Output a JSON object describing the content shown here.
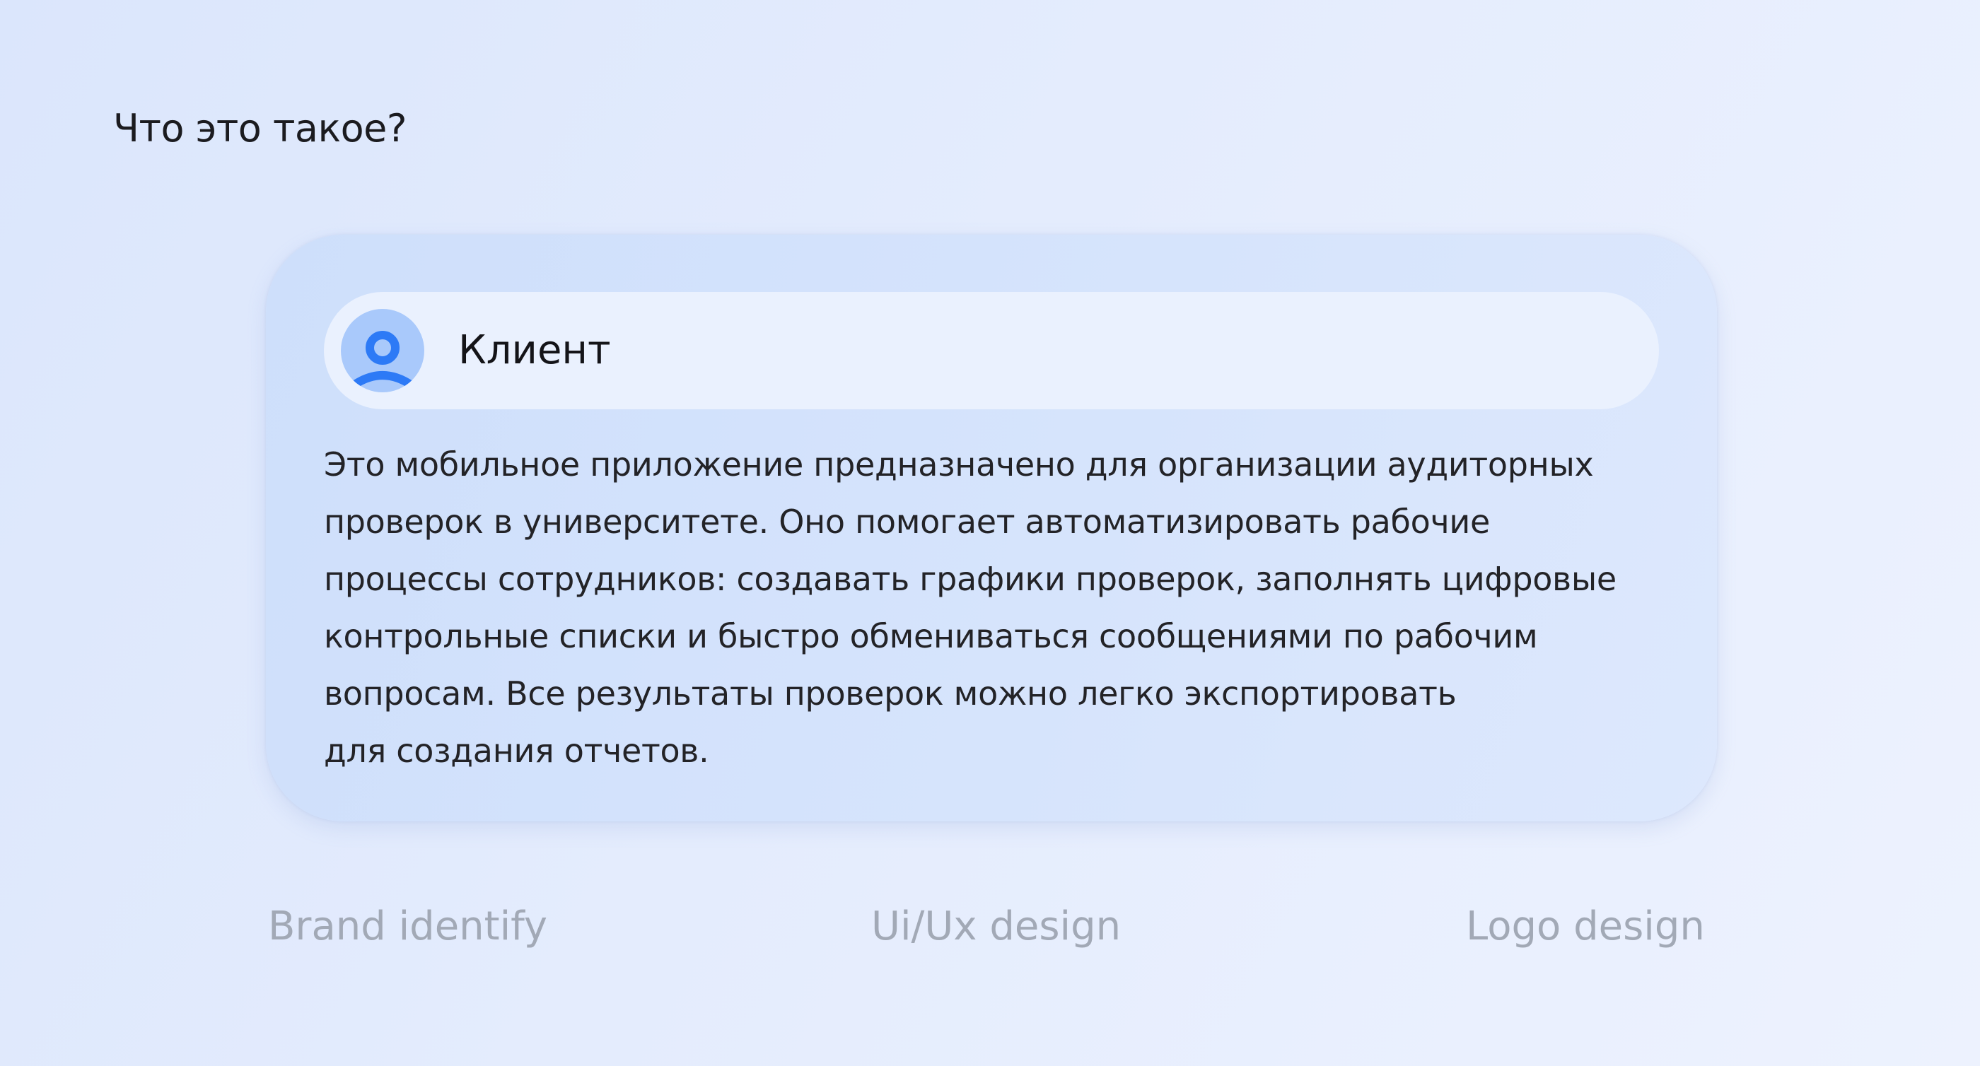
{
  "page": {
    "title": "Что это такое?"
  },
  "card": {
    "client_label": "Клиент",
    "avatar_icon": "user-icon",
    "avatar_color": "#a9c9fb",
    "avatar_accent": "#2d7af6",
    "description_lines": [
      "Это мобильное приложение предназначено для организации аудиторных",
      "проверок в университете. Оно помогает автоматизировать рабочие",
      "процессы сотрудников: создавать графики проверок, заполнять цифровые",
      "контрольные списки и быстро обмениваться сообщениями по рабочим",
      "вопросам. Все результаты проверок можно легко экспортировать",
      "для создания отчетов."
    ]
  },
  "tags": [
    "Brand identify",
    "Ui/Ux design",
    "Logo design"
  ]
}
